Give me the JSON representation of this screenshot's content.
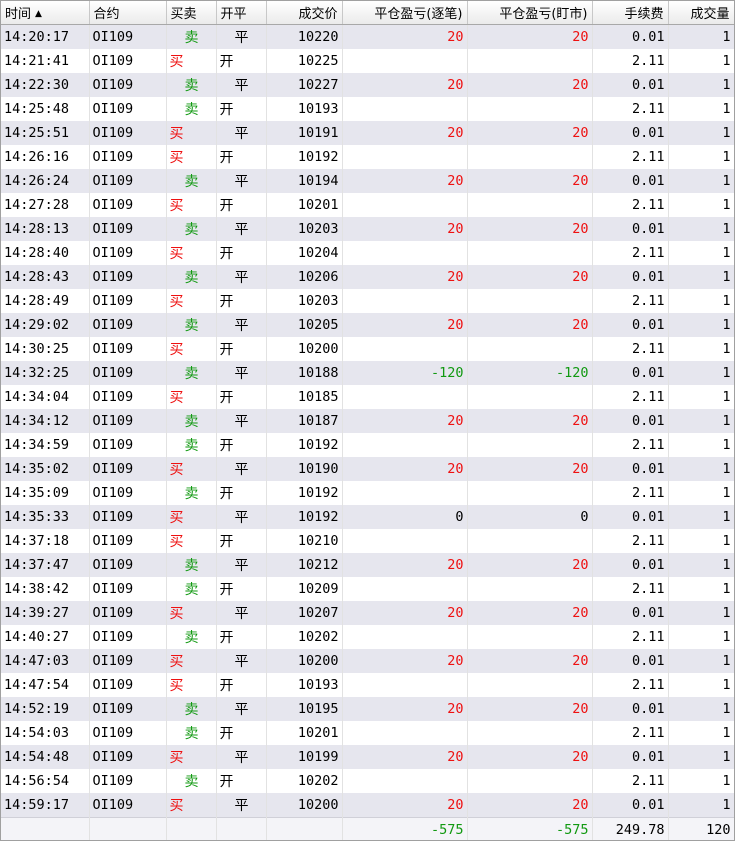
{
  "colors": {
    "buy": "#ee1111",
    "sell": "#119911",
    "profit": "#ee1111",
    "loss": "#119911"
  },
  "header": {
    "time": "时间",
    "sort_icon": "▲",
    "contract": "合约",
    "side": "买卖",
    "open_close": "开平",
    "price": "成交价",
    "pnl_trade": "平仓盈亏(逐笔)",
    "pnl_mtm": "平仓盈亏(盯市)",
    "fee": "手续费",
    "qty": "成交量"
  },
  "rows": [
    {
      "time": "14:20:17",
      "contract": "OI109",
      "side": "卖",
      "oc": "平",
      "price": "10220",
      "pnl1": "20",
      "pnl2": "20",
      "fee": "0.01",
      "qty": "1"
    },
    {
      "time": "14:21:41",
      "contract": "OI109",
      "side": "买",
      "oc": "开",
      "price": "10225",
      "pnl1": "",
      "pnl2": "",
      "fee": "2.11",
      "qty": "1"
    },
    {
      "time": "14:22:30",
      "contract": "OI109",
      "side": "卖",
      "oc": "平",
      "price": "10227",
      "pnl1": "20",
      "pnl2": "20",
      "fee": "0.01",
      "qty": "1"
    },
    {
      "time": "14:25:48",
      "contract": "OI109",
      "side": "卖",
      "oc": "开",
      "price": "10193",
      "pnl1": "",
      "pnl2": "",
      "fee": "2.11",
      "qty": "1"
    },
    {
      "time": "14:25:51",
      "contract": "OI109",
      "side": "买",
      "oc": "平",
      "price": "10191",
      "pnl1": "20",
      "pnl2": "20",
      "fee": "0.01",
      "qty": "1"
    },
    {
      "time": "14:26:16",
      "contract": "OI109",
      "side": "买",
      "oc": "开",
      "price": "10192",
      "pnl1": "",
      "pnl2": "",
      "fee": "2.11",
      "qty": "1"
    },
    {
      "time": "14:26:24",
      "contract": "OI109",
      "side": "卖",
      "oc": "平",
      "price": "10194",
      "pnl1": "20",
      "pnl2": "20",
      "fee": "0.01",
      "qty": "1"
    },
    {
      "time": "14:27:28",
      "contract": "OI109",
      "side": "买",
      "oc": "开",
      "price": "10201",
      "pnl1": "",
      "pnl2": "",
      "fee": "2.11",
      "qty": "1"
    },
    {
      "time": "14:28:13",
      "contract": "OI109",
      "side": "卖",
      "oc": "平",
      "price": "10203",
      "pnl1": "20",
      "pnl2": "20",
      "fee": "0.01",
      "qty": "1"
    },
    {
      "time": "14:28:40",
      "contract": "OI109",
      "side": "买",
      "oc": "开",
      "price": "10204",
      "pnl1": "",
      "pnl2": "",
      "fee": "2.11",
      "qty": "1"
    },
    {
      "time": "14:28:43",
      "contract": "OI109",
      "side": "卖",
      "oc": "平",
      "price": "10206",
      "pnl1": "20",
      "pnl2": "20",
      "fee": "0.01",
      "qty": "1"
    },
    {
      "time": "14:28:49",
      "contract": "OI109",
      "side": "买",
      "oc": "开",
      "price": "10203",
      "pnl1": "",
      "pnl2": "",
      "fee": "2.11",
      "qty": "1"
    },
    {
      "time": "14:29:02",
      "contract": "OI109",
      "side": "卖",
      "oc": "平",
      "price": "10205",
      "pnl1": "20",
      "pnl2": "20",
      "fee": "0.01",
      "qty": "1"
    },
    {
      "time": "14:30:25",
      "contract": "OI109",
      "side": "买",
      "oc": "开",
      "price": "10200",
      "pnl1": "",
      "pnl2": "",
      "fee": "2.11",
      "qty": "1"
    },
    {
      "time": "14:32:25",
      "contract": "OI109",
      "side": "卖",
      "oc": "平",
      "price": "10188",
      "pnl1": "-120",
      "pnl2": "-120",
      "fee": "0.01",
      "qty": "1"
    },
    {
      "time": "14:34:04",
      "contract": "OI109",
      "side": "买",
      "oc": "开",
      "price": "10185",
      "pnl1": "",
      "pnl2": "",
      "fee": "2.11",
      "qty": "1"
    },
    {
      "time": "14:34:12",
      "contract": "OI109",
      "side": "卖",
      "oc": "平",
      "price": "10187",
      "pnl1": "20",
      "pnl2": "20",
      "fee": "0.01",
      "qty": "1"
    },
    {
      "time": "14:34:59",
      "contract": "OI109",
      "side": "卖",
      "oc": "开",
      "price": "10192",
      "pnl1": "",
      "pnl2": "",
      "fee": "2.11",
      "qty": "1"
    },
    {
      "time": "14:35:02",
      "contract": "OI109",
      "side": "买",
      "oc": "平",
      "price": "10190",
      "pnl1": "20",
      "pnl2": "20",
      "fee": "0.01",
      "qty": "1"
    },
    {
      "time": "14:35:09",
      "contract": "OI109",
      "side": "卖",
      "oc": "开",
      "price": "10192",
      "pnl1": "",
      "pnl2": "",
      "fee": "2.11",
      "qty": "1"
    },
    {
      "time": "14:35:33",
      "contract": "OI109",
      "side": "买",
      "oc": "平",
      "price": "10192",
      "pnl1": "0",
      "pnl2": "0",
      "fee": "0.01",
      "qty": "1"
    },
    {
      "time": "14:37:18",
      "contract": "OI109",
      "side": "买",
      "oc": "开",
      "price": "10210",
      "pnl1": "",
      "pnl2": "",
      "fee": "2.11",
      "qty": "1"
    },
    {
      "time": "14:37:47",
      "contract": "OI109",
      "side": "卖",
      "oc": "平",
      "price": "10212",
      "pnl1": "20",
      "pnl2": "20",
      "fee": "0.01",
      "qty": "1"
    },
    {
      "time": "14:38:42",
      "contract": "OI109",
      "side": "卖",
      "oc": "开",
      "price": "10209",
      "pnl1": "",
      "pnl2": "",
      "fee": "2.11",
      "qty": "1"
    },
    {
      "time": "14:39:27",
      "contract": "OI109",
      "side": "买",
      "oc": "平",
      "price": "10207",
      "pnl1": "20",
      "pnl2": "20",
      "fee": "0.01",
      "qty": "1"
    },
    {
      "time": "14:40:27",
      "contract": "OI109",
      "side": "卖",
      "oc": "开",
      "price": "10202",
      "pnl1": "",
      "pnl2": "",
      "fee": "2.11",
      "qty": "1"
    },
    {
      "time": "14:47:03",
      "contract": "OI109",
      "side": "买",
      "oc": "平",
      "price": "10200",
      "pnl1": "20",
      "pnl2": "20",
      "fee": "0.01",
      "qty": "1"
    },
    {
      "time": "14:47:54",
      "contract": "OI109",
      "side": "买",
      "oc": "开",
      "price": "10193",
      "pnl1": "",
      "pnl2": "",
      "fee": "2.11",
      "qty": "1"
    },
    {
      "time": "14:52:19",
      "contract": "OI109",
      "side": "卖",
      "oc": "平",
      "price": "10195",
      "pnl1": "20",
      "pnl2": "20",
      "fee": "0.01",
      "qty": "1"
    },
    {
      "time": "14:54:03",
      "contract": "OI109",
      "side": "卖",
      "oc": "开",
      "price": "10201",
      "pnl1": "",
      "pnl2": "",
      "fee": "2.11",
      "qty": "1"
    },
    {
      "time": "14:54:48",
      "contract": "OI109",
      "side": "买",
      "oc": "平",
      "price": "10199",
      "pnl1": "20",
      "pnl2": "20",
      "fee": "0.01",
      "qty": "1"
    },
    {
      "time": "14:56:54",
      "contract": "OI109",
      "side": "卖",
      "oc": "开",
      "price": "10202",
      "pnl1": "",
      "pnl2": "",
      "fee": "2.11",
      "qty": "1"
    },
    {
      "time": "14:59:17",
      "contract": "OI109",
      "side": "买",
      "oc": "平",
      "price": "10200",
      "pnl1": "20",
      "pnl2": "20",
      "fee": "0.01",
      "qty": "1"
    }
  ],
  "summary": {
    "pnl1": "-575",
    "pnl2": "-575",
    "fee": "249.78",
    "qty": "120"
  }
}
